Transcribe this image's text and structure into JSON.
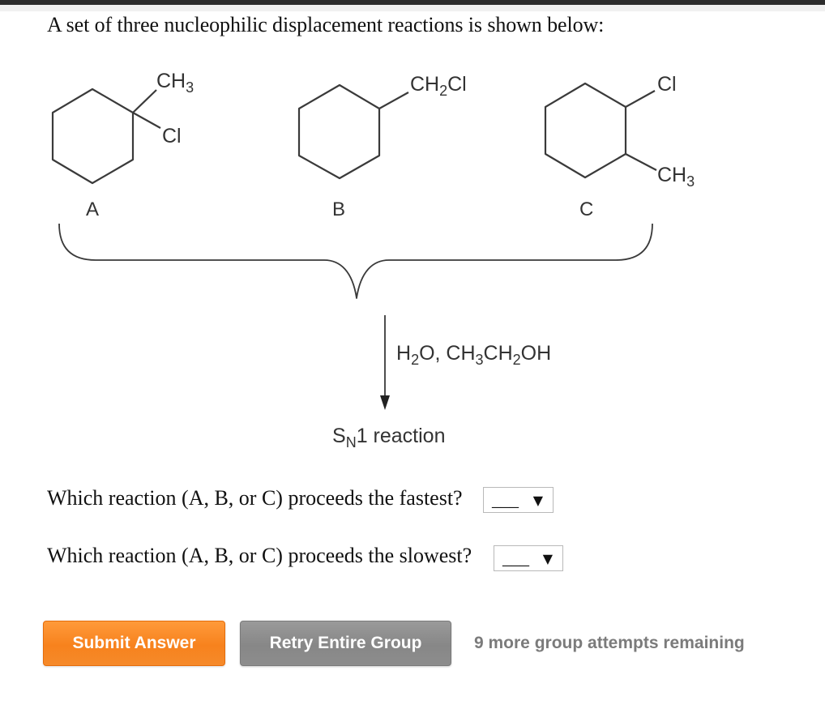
{
  "intro": "A set of three nucleophilic displacement reactions is shown below:",
  "compounds": [
    {
      "label": "A",
      "substituents": [
        "CH3",
        "Cl"
      ],
      "name": "1-chloro-1-methylcyclohexane"
    },
    {
      "label": "B",
      "substituents": [
        "CH2Cl"
      ],
      "name": "(chloromethyl)cyclohexane"
    },
    {
      "label": "C",
      "substituents": [
        "Cl",
        "CH3"
      ],
      "name": "1-chloro-2-methylcyclohexane"
    }
  ],
  "labels": {
    "a_ch3_main": "CH",
    "a_ch3_sub": "3",
    "a_cl": "Cl",
    "b_ch2cl_ch": "CH",
    "b_ch2cl_sub": "2",
    "b_ch2cl_cl": "Cl",
    "c_cl": "Cl",
    "c_ch3_main": "CH",
    "c_ch3_sub": "3",
    "compound_a": "A",
    "compound_b": "B",
    "compound_c": "C"
  },
  "conditions": {
    "h": "H",
    "h_sub": "2",
    "o_comma": "O, CH",
    "ch3_sub": "3",
    "ch": "CH",
    "ch2_sub": "2",
    "oh": "OH",
    "full_text": "H2O, CH3CH2OH"
  },
  "reaction_type": {
    "s": "S",
    "n_sub": "N",
    "rest": "1 reaction",
    "full_text": "SN1 reaction"
  },
  "questions": [
    {
      "text": "Which reaction (A, B, or C) proceeds the fastest?",
      "selected": "___",
      "arrow": "▼"
    },
    {
      "text": "Which reaction (A, B, or C) proceeds the slowest?",
      "selected": "___",
      "arrow": "▼"
    }
  ],
  "buttons": {
    "submit": "Submit Answer",
    "retry": "Retry Entire Group"
  },
  "attempts_text": "9 more group attempts remaining",
  "colors": {
    "submit_bg": "#f7821d",
    "retry_bg": "#878787",
    "attempts_text": "#7b7b7b"
  }
}
